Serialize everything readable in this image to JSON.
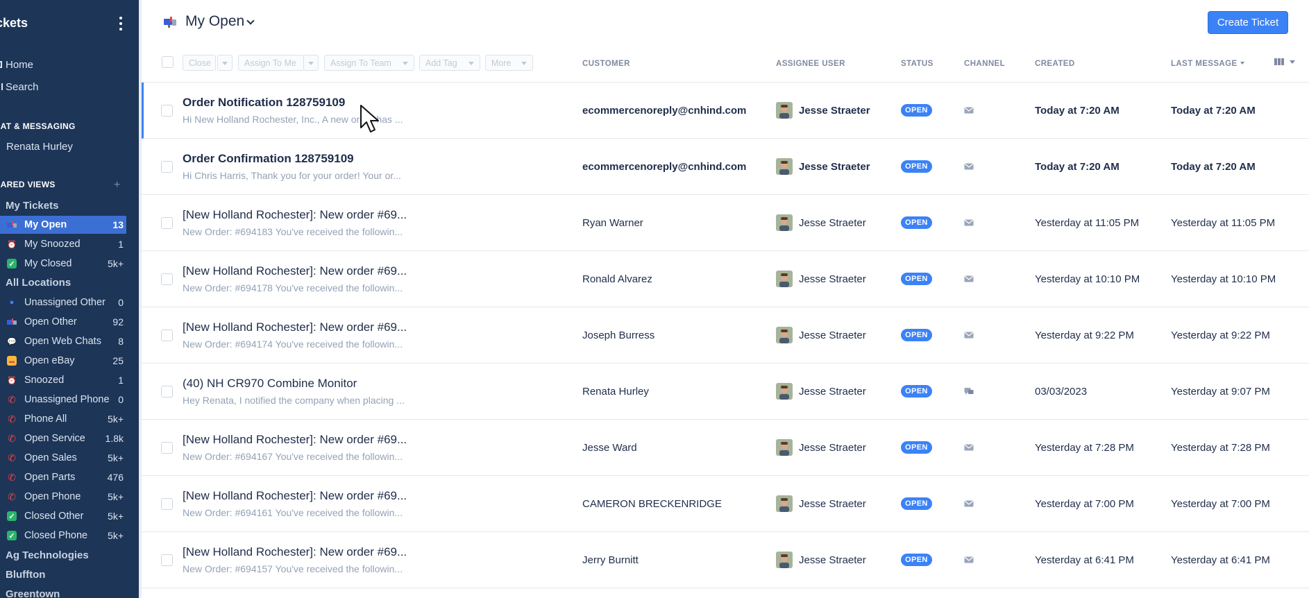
{
  "sidebar": {
    "title": "ckets",
    "nav": [
      {
        "label": "Home",
        "icon": "home-icon"
      },
      {
        "label": "Search",
        "icon": "search-icon"
      }
    ],
    "chat_section": "IAT & MESSAGING",
    "chat_contact": "Renata Hurley",
    "shared_views_section": "IARED VIEWS",
    "my_tickets_group": "My Tickets",
    "my_items": [
      {
        "label": "My Open",
        "count": "13",
        "icon": "mailbox-icon",
        "active": true
      },
      {
        "label": "My Snoozed",
        "count": "1",
        "icon": "alarm-clock-icon"
      },
      {
        "label": "My Closed",
        "count": "5k+",
        "icon": "check-icon"
      }
    ],
    "all_locations_group": "All Locations",
    "location_items": [
      {
        "label": "Unassigned Other",
        "count": "0",
        "icon": "pin-icon"
      },
      {
        "label": "Open Other",
        "count": "92",
        "icon": "mailbox-icon"
      },
      {
        "label": "Open Web Chats",
        "count": "8",
        "icon": "chat-bubble-icon"
      },
      {
        "label": "Open eBay",
        "count": "25",
        "icon": "ebay-icon"
      },
      {
        "label": "Snoozed",
        "count": "1",
        "icon": "alarm-clock-icon"
      },
      {
        "label": "Unassigned Phone",
        "count": "0",
        "icon": "phone-icon"
      },
      {
        "label": "Phone All",
        "count": "5k+",
        "icon": "phone-icon"
      },
      {
        "label": "Open Service",
        "count": "1.8k",
        "icon": "phone-icon"
      },
      {
        "label": "Open Sales",
        "count": "5k+",
        "icon": "phone-icon"
      },
      {
        "label": "Open Parts",
        "count": "476",
        "icon": "phone-icon"
      },
      {
        "label": "Open Phone",
        "count": "5k+",
        "icon": "phone-icon"
      },
      {
        "label": "Closed Other",
        "count": "5k+",
        "icon": "check-icon"
      },
      {
        "label": "Closed Phone",
        "count": "5k+",
        "icon": "check-icon"
      }
    ],
    "extra_groups": [
      "Ag Technologies",
      "Bluffton",
      "Greentown"
    ]
  },
  "header": {
    "title": "My Open",
    "create_button": "Create Ticket"
  },
  "toolbar": {
    "close": "Close",
    "assign_to_me": "Assign To Me",
    "assign_to_team": "Assign To Team",
    "add_tag": "Add Tag",
    "more": "More"
  },
  "columns": {
    "customer": "CUSTOMER",
    "assignee": "ASSIGNEE USER",
    "status": "STATUS",
    "channel": "CHANNEL",
    "created": "CREATED",
    "last_message": "LAST MESSAGE"
  },
  "colors": {
    "sidebar_bg": "#1d3557",
    "accent": "#3b82f6",
    "status_open": "#3b82f6"
  },
  "tickets": [
    {
      "subject": "Order Notification 128759109",
      "preview": "Hi New Holland Rochester, Inc., A new order has ...",
      "customer": "ecommercenoreply@cnhind.com",
      "assignee": "Jesse Straeter",
      "status": "OPEN",
      "channel": "email-icon",
      "created": "Today at 7:20 AM",
      "last_message": "Today at 7:20 AM",
      "unread": true,
      "selected": true
    },
    {
      "subject": "Order Confirmation 128759109",
      "preview": "Hi Chris Harris, Thank you for your order! Your or...",
      "customer": "ecommercenoreply@cnhind.com",
      "assignee": "Jesse Straeter",
      "status": "OPEN",
      "channel": "email-icon",
      "created": "Today at 7:20 AM",
      "last_message": "Today at 7:20 AM",
      "unread": true
    },
    {
      "subject": "[New Holland Rochester]: New order #69...",
      "preview": "New Order: #694183 You've received the followin...",
      "customer": "Ryan Warner",
      "assignee": "Jesse Straeter",
      "status": "OPEN",
      "channel": "email-icon",
      "created": "Yesterday at 11:05 PM",
      "last_message": "Yesterday at 11:05 PM"
    },
    {
      "subject": "[New Holland Rochester]: New order #69...",
      "preview": "New Order: #694178 You've received the followin...",
      "customer": "Ronald Alvarez",
      "assignee": "Jesse Straeter",
      "status": "OPEN",
      "channel": "email-icon",
      "created": "Yesterday at 10:10 PM",
      "last_message": "Yesterday at 10:10 PM"
    },
    {
      "subject": "[New Holland Rochester]: New order #69...",
      "preview": "New Order: #694174 You've received the followin...",
      "customer": "Joseph Burress",
      "assignee": "Jesse Straeter",
      "status": "OPEN",
      "channel": "email-icon",
      "created": "Yesterday at 9:22 PM",
      "last_message": "Yesterday at 9:22 PM"
    },
    {
      "subject": "(40) NH CR970 Combine Monitor",
      "preview": "Hey Renata, I notified the company when placing ...",
      "customer": "Renata Hurley",
      "assignee": "Jesse Straeter",
      "status": "OPEN",
      "channel": "chat-icon",
      "created": "03/03/2023",
      "last_message": "Yesterday at 9:07 PM"
    },
    {
      "subject": "[New Holland Rochester]: New order #69...",
      "preview": "New Order: #694167 You've received the followin...",
      "customer": "Jesse Ward",
      "assignee": "Jesse Straeter",
      "status": "OPEN",
      "channel": "email-icon",
      "created": "Yesterday at 7:28 PM",
      "last_message": "Yesterday at 7:28 PM"
    },
    {
      "subject": "[New Holland Rochester]: New order #69...",
      "preview": "New Order: #694161 You've received the followin...",
      "customer": "CAMERON BRECKENRIDGE",
      "assignee": "Jesse Straeter",
      "status": "OPEN",
      "channel": "email-icon",
      "created": "Yesterday at 7:00 PM",
      "last_message": "Yesterday at 7:00 PM"
    },
    {
      "subject": "[New Holland Rochester]: New order #69...",
      "preview": "New Order: #694157 You've received the followin...",
      "customer": "Jerry Burnitt",
      "assignee": "Jesse Straeter",
      "status": "OPEN",
      "channel": "email-icon",
      "created": "Yesterday at 6:41 PM",
      "last_message": "Yesterday at 6:41 PM"
    }
  ]
}
